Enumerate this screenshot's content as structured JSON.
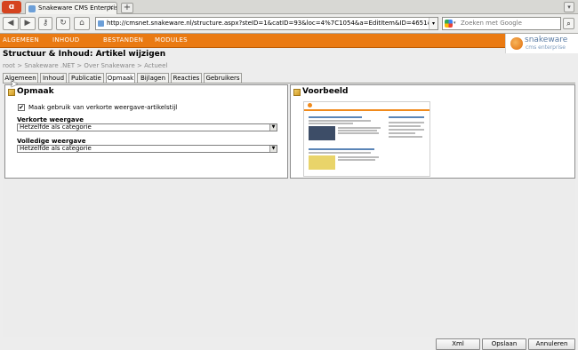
{
  "browser": {
    "ff_label": "",
    "tab_title": "Snakeware CMS Enterpris...",
    "url": "http://cmsnet.snakeware.nl/structure.aspx?steID=1&catID=93&loc=4%7C1054&a=EditItem&ID=4651&r=http://cmsnet.snakeware",
    "search_placeholder": "Zoeken met Google"
  },
  "app": {
    "menu": [
      "ALGEMEEN",
      "INHOUD",
      "BESTANDEN",
      "MODULES"
    ],
    "logo_name": "snakeware",
    "logo_sub": "cms enterprise",
    "colors": {
      "accent": "#ea7a12",
      "logo_text": "#5b7ca4"
    }
  },
  "page": {
    "title": "Structuur & Inhoud: Artikel wijzigen",
    "breadcrumb": "root  >  Snakeware .NET  >  Over Snakeware  >  Actueel"
  },
  "tabs": [
    {
      "label": "Algemeen",
      "active": false
    },
    {
      "label": "Inhoud",
      "active": false
    },
    {
      "label": "Publicatie",
      "active": false
    },
    {
      "label": "Opmaak",
      "active": true
    },
    {
      "label": "Bijlagen",
      "active": false
    },
    {
      "label": "Reacties",
      "active": false
    },
    {
      "label": "Gebruikers",
      "active": false
    }
  ],
  "opmaak": {
    "title": "Opmaak",
    "checkbox_label": "Maak gebruik van verkorte weergave-artikelstijl",
    "checkbox_checked": true,
    "verkorte_label": "Verkorte weergave",
    "verkorte_value": "Hetzelfde als categorie",
    "volledige_label": "Volledige weergave",
    "volledige_value": "Hetzelfde als categorie"
  },
  "voorbeeld": {
    "title": "Voorbeeld"
  },
  "buttons": {
    "xml": "Xml",
    "opslaan": "Opslaan",
    "annuleren": "Annuleren"
  }
}
